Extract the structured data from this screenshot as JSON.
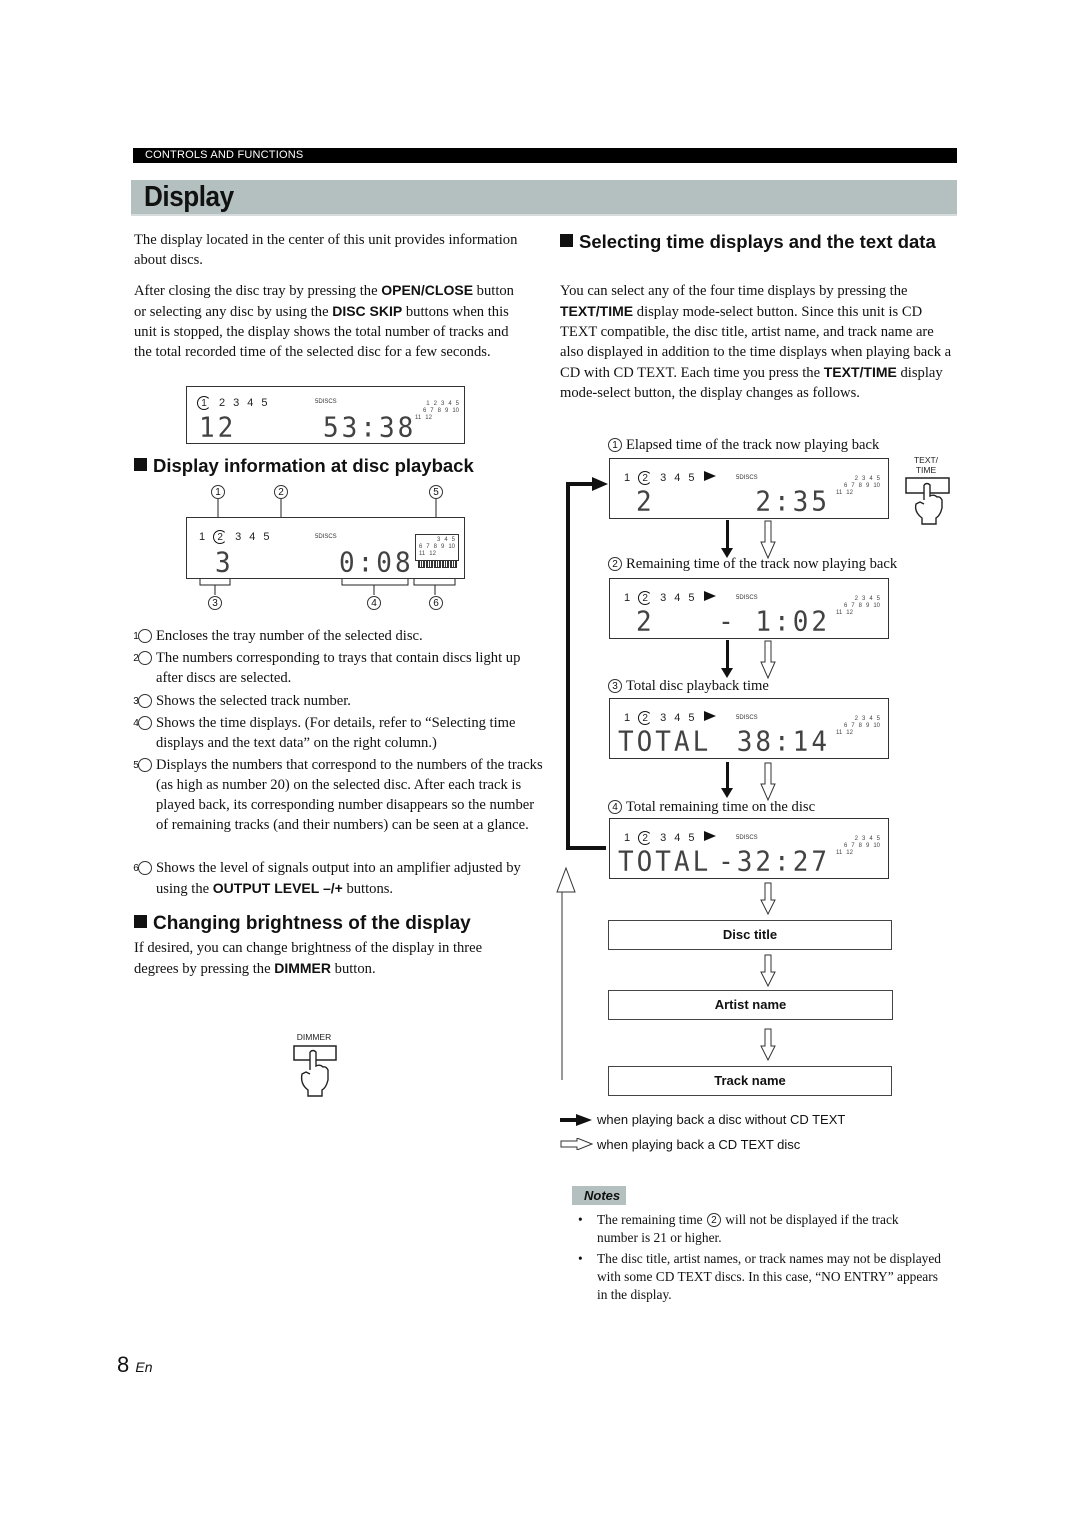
{
  "header": {
    "section_label": "CONTROLS AND FUNCTIONS",
    "page_title": "Display"
  },
  "intro": {
    "p1": "The display located in the center of this unit provides information about discs.",
    "p2_a": "After closing the disc tray by pressing the ",
    "p2_b1": "OPEN/CLOSE",
    "p2_c": " button or selecting any disc by using the ",
    "p2_b2": "DISC SKIP",
    "p2_d": " buttons when this unit is stopped, the display shows the total number of tracks and the total recorded time of the selected disc for a few seconds."
  },
  "lcd_stopped": {
    "trays": [
      "1",
      "2",
      "3",
      "4",
      "5"
    ],
    "selected_tray": "1",
    "discs_label": "5DISCS",
    "track_rows": [
      [
        "1",
        "2",
        "3",
        "4",
        "5"
      ],
      [
        "6",
        "7",
        "8",
        "9",
        "10"
      ],
      [
        "11",
        "12"
      ]
    ],
    "track_count": "12",
    "time": "53:38"
  },
  "section_playback": {
    "heading": "Display information at disc playback",
    "callouts": [
      "1",
      "2",
      "3",
      "4",
      "5",
      "6"
    ],
    "lcd": {
      "trays": [
        "1",
        "2",
        "3",
        "4",
        "5"
      ],
      "selected_tray": "2",
      "discs_label": "5DISCS",
      "track_rows": [
        [
          "3",
          "4",
          "5"
        ],
        [
          "6",
          "7",
          "8",
          "9",
          "10"
        ],
        [
          "11",
          "12"
        ]
      ],
      "track": "3",
      "time": "0:08",
      "level_meter_segments": 5
    },
    "items": [
      {
        "n": "1",
        "text": "Encloses the tray number of the selected disc."
      },
      {
        "n": "2",
        "text": "The numbers corresponding to trays that contain discs light up after discs are selected."
      },
      {
        "n": "3",
        "text": "Shows the selected track number."
      },
      {
        "n": "4",
        "text": "Shows the time displays. (For details, refer to “Selecting time displays and the text data” on the right column.)"
      },
      {
        "n": "5",
        "text": "Displays the numbers that correspond to the numbers of the tracks (as high as number 20) on the selected disc. After each track is played back, its corresponding number disappears so the number of remaining tracks (and their numbers) can be seen at a glance."
      },
      {
        "n": "6",
        "text_a": "Shows the level of signals output into an amplifier adjusted by using the ",
        "text_b": "OUTPUT LEVEL –/+",
        "text_c": " buttons."
      }
    ]
  },
  "section_brightness": {
    "heading": "Changing brightness of the display",
    "text_a": "If desired, you can change brightness of the display in three degrees by pressing the ",
    "text_b": "DIMMER",
    "text_c": " button.",
    "button_label": "DIMMER"
  },
  "section_select": {
    "heading": "Selecting time displays and the text data",
    "text_a": "You can select any of the four time displays by pressing the ",
    "text_b": "TEXT/TIME",
    "text_c": " display mode-select button. Since this unit is CD TEXT compatible, the disc title, artist name, and track name are also displayed in addition to the time displays when playing back a CD with CD TEXT. Each time you press the ",
    "text_d": "TEXT/TIME",
    "text_e": " display mode-select button, the display changes as follows.",
    "button_label_1": "TEXT/",
    "button_label_2": "TIME",
    "modes": [
      {
        "n": "1",
        "caption": "Elapsed time of the track now playing back",
        "left": "2",
        "right": "2:35"
      },
      {
        "n": "2",
        "caption": "Remaining time of the track now playing back",
        "left": "2",
        "right": "- 1:02"
      },
      {
        "n": "3",
        "caption": "Total disc playback time",
        "left": "TOTAL",
        "right": "38:14"
      },
      {
        "n": "4",
        "caption": "Total remaining time on the disc",
        "left": "TOTAL",
        "right": "-32:27"
      }
    ],
    "mode_lcd": {
      "trays": [
        "1",
        "2",
        "3",
        "4",
        "5"
      ],
      "selected_tray": "2",
      "discs_label": "5DISCS",
      "track_rows": [
        [
          "2",
          "3",
          "4",
          "5"
        ],
        [
          "6",
          "7",
          "8",
          "9",
          "10"
        ],
        [
          "11",
          "12"
        ]
      ]
    },
    "text_modes": [
      "Disc title",
      "Artist name",
      "Track name"
    ],
    "legend": [
      {
        "icon": "solid-arrow",
        "text": "when playing back a disc without CD TEXT"
      },
      {
        "icon": "outline-arrow",
        "text": "when playing back a CD TEXT disc"
      }
    ]
  },
  "notes": {
    "label": "Notes",
    "items": [
      {
        "a": "The remaining time ",
        "n": "2",
        "b": " will not be displayed if the track number is 21 or higher."
      },
      {
        "a": "The disc title, artist names, or track names may not be displayed with some CD TEXT discs. In this case, “NO ENTRY” appears in the display."
      }
    ]
  },
  "footer": {
    "page_number": "8",
    "lang": "En"
  }
}
